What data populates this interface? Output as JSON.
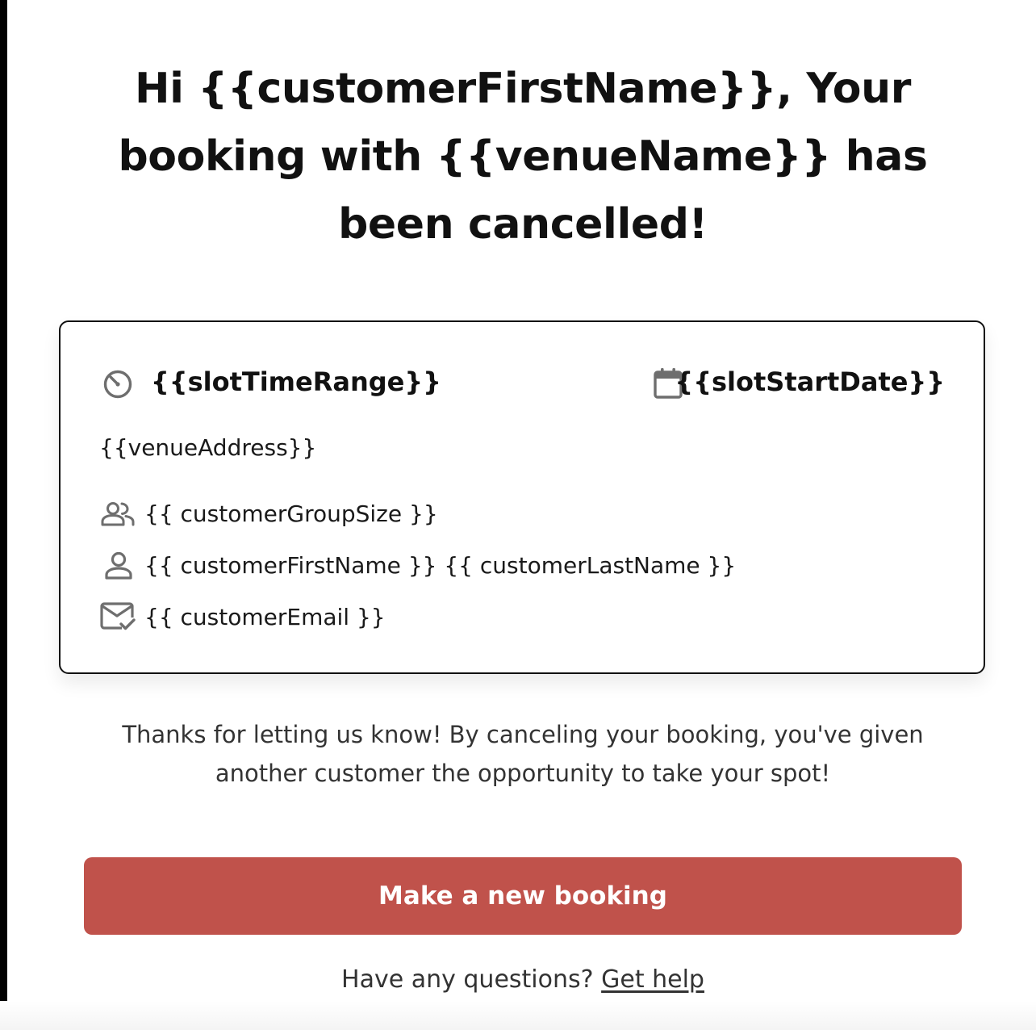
{
  "header": {
    "title": "Hi {{customerFirstName}}, Your booking with {{venueName}} has been cancelled!"
  },
  "booking_card": {
    "time": {
      "icon": "timer-icon",
      "value": "{{slotTimeRange}}"
    },
    "date": {
      "icon": "calendar-icon",
      "value": "{{slotStartDate}}"
    },
    "address": "{{venueAddress}}",
    "group_size": {
      "icon": "group-icon",
      "value": "{{ customerGroupSize }}"
    },
    "customer_name": {
      "icon": "person-icon",
      "value": "{{ customerFirstName }} {{ customerLastName }}"
    },
    "customer_email": {
      "icon": "mail-check-icon",
      "value": "{{ customerEmail }}"
    }
  },
  "message": "Thanks for letting us know! By canceling your booking, you've given another customer the opportunity to take your spot!",
  "cta": {
    "label": "Make a new booking"
  },
  "help": {
    "prompt": "Have any questions?",
    "link_label": "Get help"
  },
  "colors": {
    "button_background": "#c0524b",
    "button_text": "#ffffff",
    "heading_text": "#111111",
    "body_text": "#333333",
    "icon_gray": "#6e6e6e"
  }
}
